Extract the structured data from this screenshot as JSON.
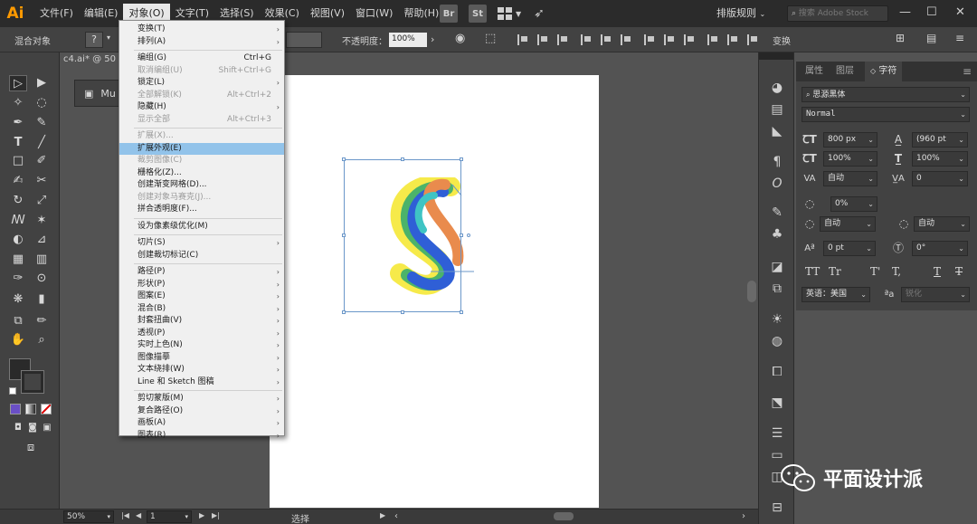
{
  "app": {
    "logo": "Ai"
  },
  "menubar": {
    "items": [
      "文件(F)",
      "编辑(E)",
      "对象(O)",
      "文字(T)",
      "选择(S)",
      "效果(C)",
      "视图(V)",
      "窗口(W)",
      "帮助(H)"
    ],
    "active": "对象(O)",
    "bridge_label": "Br",
    "stock_label": "St",
    "workspace": "排版规则",
    "stock_search_placeholder": "搜索 Adobe Stock"
  },
  "control_bar": {
    "selection_label": "混合对象",
    "opacity_label": "不透明度：",
    "opacity_value": "100%",
    "transform_label": "变换"
  },
  "doc_tab": {
    "title": "c4.ai* @ 50"
  },
  "float_panel_label": "Mu",
  "dropdown": {
    "items": [
      {
        "label": "变换(T)",
        "submenu": true
      },
      {
        "label": "排列(A)",
        "submenu": true
      },
      {
        "sep": true
      },
      {
        "label": "编组(G)",
        "shortcut": "Ctrl+G"
      },
      {
        "label": "取消编组(U)",
        "shortcut": "Shift+Ctrl+G",
        "disabled": true
      },
      {
        "label": "锁定(L)",
        "submenu": true
      },
      {
        "label": "全部解锁(K)",
        "shortcut": "Alt+Ctrl+2",
        "disabled": true
      },
      {
        "label": "隐藏(H)",
        "submenu": true
      },
      {
        "label": "显示全部",
        "shortcut": "Alt+Ctrl+3",
        "disabled": true
      },
      {
        "sep": true
      },
      {
        "label": "扩展(X)...",
        "disabled": true
      },
      {
        "label": "扩展外观(E)",
        "highlight": true
      },
      {
        "label": "裁剪图像(C)",
        "disabled": true
      },
      {
        "label": "栅格化(Z)..."
      },
      {
        "label": "创建渐变网格(D)..."
      },
      {
        "label": "创建对象马赛克(J)...",
        "disabled": true
      },
      {
        "label": "拼合透明度(F)..."
      },
      {
        "sep": true
      },
      {
        "label": "设为像素级优化(M)"
      },
      {
        "sep": true
      },
      {
        "label": "切片(S)",
        "submenu": true
      },
      {
        "label": "创建裁切标记(C)"
      },
      {
        "sep": true
      },
      {
        "label": "路径(P)",
        "submenu": true
      },
      {
        "label": "形状(P)",
        "submenu": true
      },
      {
        "label": "图案(E)",
        "submenu": true
      },
      {
        "label": "混合(B)",
        "submenu": true
      },
      {
        "label": "封套扭曲(V)",
        "submenu": true
      },
      {
        "label": "透视(P)",
        "submenu": true
      },
      {
        "label": "实时上色(N)",
        "submenu": true
      },
      {
        "label": "图像描摹",
        "submenu": true
      },
      {
        "label": "文本绕排(W)",
        "submenu": true
      },
      {
        "label": "Line 和 Sketch 图稿",
        "submenu": true
      },
      {
        "sep": true
      },
      {
        "label": "剪切蒙版(M)",
        "submenu": true
      },
      {
        "label": "复合路径(O)",
        "submenu": true
      },
      {
        "label": "画板(A)",
        "submenu": true
      },
      {
        "label": "图表(R)",
        "submenu": true
      }
    ]
  },
  "character_panel": {
    "tabs": [
      "属性",
      "图层",
      "字符"
    ],
    "active_tab": "字符",
    "font_family": "思源黑体",
    "font_style": "Normal",
    "font_size": "800 px",
    "leading": "(960 pt",
    "vertical_scale": "100%",
    "horizontal_scale": "100%",
    "kerning": "自动",
    "tracking": "0",
    "tsume": "0%",
    "aki_left": "自动",
    "aki_right": "自动",
    "baseline_shift": "0 pt",
    "rotation": "0°",
    "language": "英语：美国",
    "aa_method": "锐化"
  },
  "status_bar": {
    "zoom": "50%",
    "artboard_num": "1",
    "tool_label": "选择"
  },
  "watermark": {
    "text": "平面设计派"
  },
  "colors": {
    "menu_highlight": "#92c3ea",
    "logo": "#ff9a00",
    "frame": "#6b97c9"
  }
}
